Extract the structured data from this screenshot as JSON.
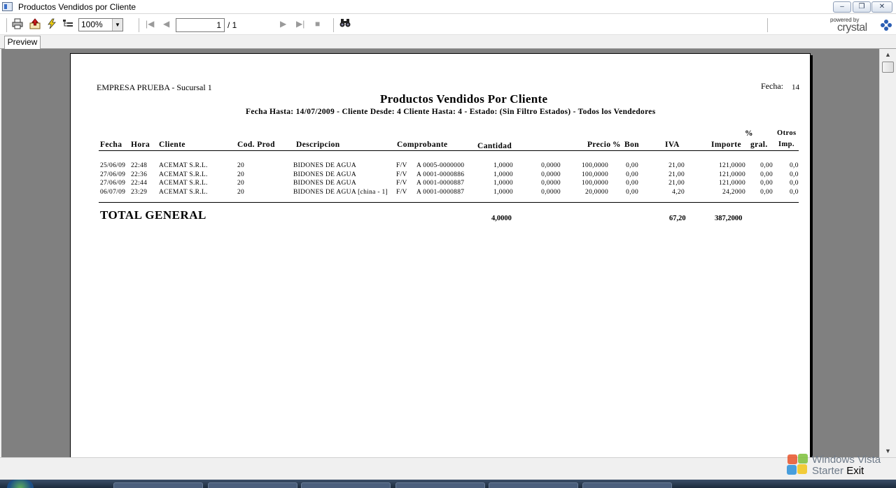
{
  "window": {
    "title": "Productos Vendidos por Cliente",
    "minimize": "–",
    "restore": "❐",
    "close": "✕"
  },
  "toolbar": {
    "zoom": "100%",
    "page_current": "1",
    "page_total": "/ 1",
    "crystal_powered": "powered by",
    "crystal_brand": "crystal"
  },
  "tabs": {
    "preview": "Preview"
  },
  "report": {
    "company": "EMPRESA PRUEBA - Sucursal 1",
    "title": "Productos Vendidos Por Cliente",
    "subtitle": "Fecha Hasta: 14/07/2009 - Cliente Desde: 4 Cliente Hasta: 4 - Estado: (Sin Filtro Estados) - Todos los Vendedores",
    "fecha_label": "Fecha:",
    "fecha_value": "14",
    "headers": {
      "fecha": "Fecha",
      "hora": "Hora",
      "cliente": "Cliente",
      "cod_prod": "Cod. Prod",
      "descripcion": "Descripcion",
      "comprobante": "Comprobante",
      "cantidad": "Cantidad",
      "precio": "Precio",
      "pct_bon_top": "%",
      "bon": "Bon",
      "iva": "IVA",
      "importe": "Importe",
      "pct_gral_top": "%",
      "gral": "gral.",
      "otros_top": "Otros",
      "imp": "Imp."
    },
    "rows": [
      [
        "25/06/09",
        "22:48",
        "ACEMAT S.R.L.",
        "20",
        "BIDONES DE AGUA",
        "F/V",
        "A 0005-0000000",
        "1,0000",
        "0,0000",
        "100,0000",
        "0,00",
        "21,00",
        "121,0000",
        "0,00",
        "0,0"
      ],
      [
        "27/06/09",
        "22:36",
        "ACEMAT S.R.L.",
        "20",
        "BIDONES DE AGUA",
        "F/V",
        "A 0001-0000886",
        "1,0000",
        "0,0000",
        "100,0000",
        "0,00",
        "21,00",
        "121,0000",
        "0,00",
        "0,0"
      ],
      [
        "27/06/09",
        "22:44",
        "ACEMAT S.R.L.",
        "20",
        "BIDONES DE AGUA",
        "F/V",
        "A 0001-0000887",
        "1,0000",
        "0,0000",
        "100,0000",
        "0,00",
        "21,00",
        "121,0000",
        "0,00",
        "0,0"
      ],
      [
        "06/07/09",
        "23:29",
        "ACEMAT S.R.L.",
        "20",
        "BIDONES DE AGUA [china - 1]",
        "F/V",
        "A 0001-0000887",
        "1,0000",
        "0,0000",
        "20,0000",
        "0,00",
        "4,20",
        "24,2000",
        "0,00",
        "0,0"
      ]
    ],
    "total_label": "TOTAL GENERAL",
    "total_cantidad": "4,0000",
    "total_iva": "67,20",
    "total_importe": "387,2000"
  },
  "watermark": {
    "line1": "Windows Vista",
    "line2": "Starter",
    "exit": "Exit"
  }
}
